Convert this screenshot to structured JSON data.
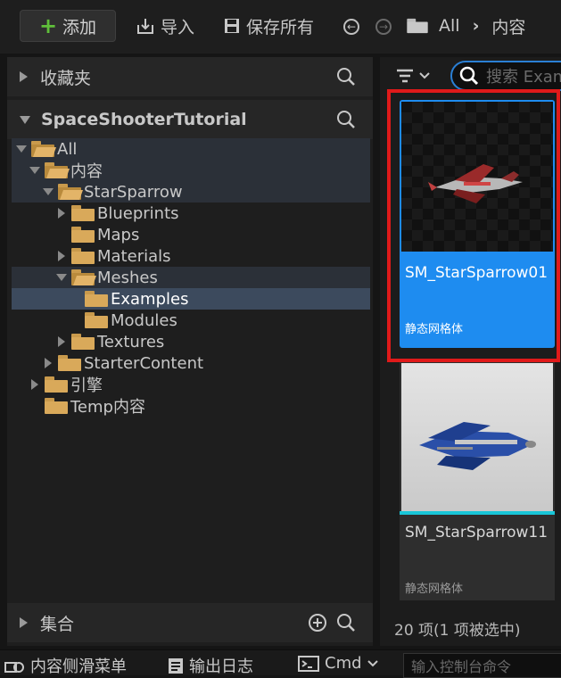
{
  "toolbar": {
    "add_label": "添加",
    "import_label": "导入",
    "save_all_label": "保存所有",
    "breadcrumb": [
      "All",
      "内容"
    ]
  },
  "left_panel": {
    "favorites_label": "收藏夹",
    "project_label": "SpaceShooterTutorial",
    "collections_label": "集合",
    "tree": [
      {
        "label": "All",
        "depth": 0,
        "expanded": true,
        "highlight": true
      },
      {
        "label": "内容",
        "depth": 1,
        "expanded": true,
        "highlight": true
      },
      {
        "label": "StarSparrow",
        "depth": 2,
        "expanded": true,
        "highlight": true
      },
      {
        "label": "Blueprints",
        "depth": 3,
        "expanded": false,
        "has_children": true
      },
      {
        "label": "Maps",
        "depth": 3,
        "has_children": false
      },
      {
        "label": "Materials",
        "depth": 3,
        "expanded": false,
        "has_children": true
      },
      {
        "label": "Meshes",
        "depth": 3,
        "expanded": true,
        "highlight": true
      },
      {
        "label": "Examples",
        "depth": 4,
        "selected": true
      },
      {
        "label": "Modules",
        "depth": 4
      },
      {
        "label": "Textures",
        "depth": 3,
        "expanded": false,
        "has_children": true
      },
      {
        "label": "StarterContent",
        "depth": 2,
        "expanded": false,
        "has_children": true
      },
      {
        "label": "引擎",
        "depth": 1,
        "expanded": false,
        "has_children": true
      },
      {
        "label": "Temp内容",
        "depth": 1,
        "has_children": false
      }
    ]
  },
  "right_panel": {
    "search_placeholder": "搜索 Exam",
    "assets": [
      {
        "name": "SM_StarSparrow01",
        "type": "静态网格体",
        "selected": true
      },
      {
        "name": "SM_StarSparrow11",
        "type": "静态网格体",
        "selected": false
      }
    ],
    "item_count": "20 项(1 项被选中)"
  },
  "bottom_bar": {
    "content_drawer": "内容侧滑菜单",
    "output_log": "输出日志",
    "cmd": "Cmd",
    "console_placeholder": "输入控制台命令"
  },
  "colors": {
    "accent": "#1e8cf0",
    "selection_box": "#e01a1a",
    "add_plus": "#5fbf3a",
    "folder": "#d9a95a"
  }
}
